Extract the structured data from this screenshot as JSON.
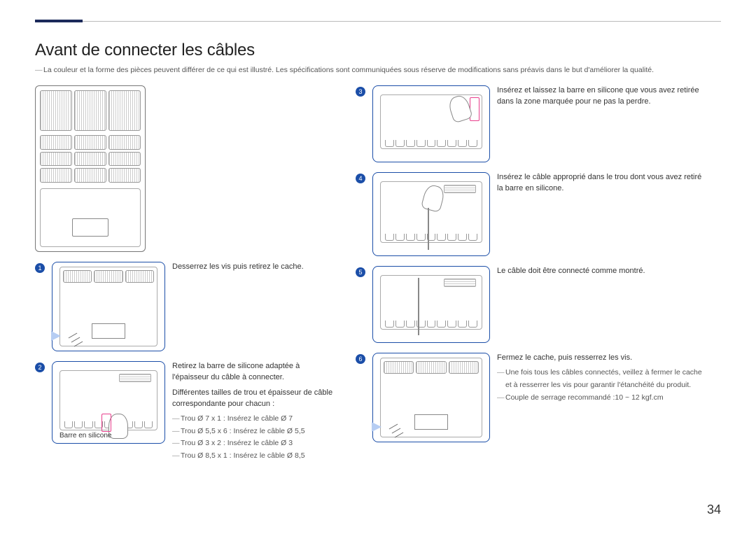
{
  "header": {
    "title": "Avant de connecter les câbles",
    "intro": "La couleur et la forme des pièces peuvent différer de ce qui est illustré. Les spécifications sont communiquées sous réserve de modifications sans préavis dans le but d'améliorer la qualité."
  },
  "figure2_label": "Barre en silicone",
  "steps": {
    "s1": {
      "num": "1",
      "text": "Desserrez les vis puis retirez le cache."
    },
    "s2": {
      "num": "2",
      "line1": "Retirez la barre de silicone adaptée à l'épaisseur du câble à connecter.",
      "line2": "Différentes tailles de trou et épaisseur de câble correspondante pour chacun :",
      "holes": [
        "Trou Ø 7 x 1 : Insérez le câble Ø 7",
        "Trou Ø 5,5 x 6 : Insérez le câble Ø 5,5",
        "Trou Ø 3 x 2 : Insérez le câble Ø 3",
        "Trou Ø 8,5 x 1 : Insérez le câble Ø 8,5"
      ]
    },
    "s3": {
      "num": "3",
      "text": "Insérez et laissez la barre en silicone que vous avez retirée dans la zone marquée pour ne pas la perdre."
    },
    "s4": {
      "num": "4",
      "text": "Insérez le câble approprié dans le trou dont vous avez retiré la barre en silicone."
    },
    "s5": {
      "num": "5",
      "text": "Le câble doit être connecté comme montré."
    },
    "s6": {
      "num": "6",
      "text": "Fermez le cache, puis resserrez les vis.",
      "notes": [
        "Une fois tous les câbles connectés, veillez à fermer le cache et à resserrer les vis pour garantir l'étanchéité du produit.",
        "Couple de serrage recommandé :10 ~ 12 kgf.cm"
      ]
    }
  },
  "page_number": "34"
}
